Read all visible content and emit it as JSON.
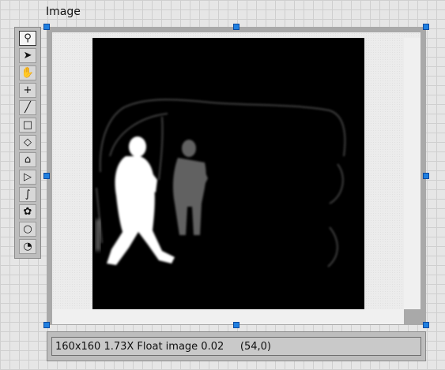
{
  "control": {
    "label": "Image"
  },
  "toolbar": {
    "tools": [
      {
        "name": "zoom-icon",
        "glyph": "⚲",
        "selected": true
      },
      {
        "name": "pointer-icon",
        "glyph": "➤",
        "selected": false
      },
      {
        "name": "pan-hand-icon",
        "glyph": "✋",
        "selected": false
      },
      {
        "name": "point-tool-icon",
        "glyph": "+",
        "selected": false
      },
      {
        "name": "line-tool-icon",
        "glyph": "╱",
        "selected": false
      },
      {
        "name": "rectangle-tool-icon",
        "glyph": "□",
        "selected": false
      },
      {
        "name": "rotated-rectangle-tool-icon",
        "glyph": "◇",
        "selected": false
      },
      {
        "name": "polyline-tool-icon",
        "glyph": "⌂",
        "selected": false
      },
      {
        "name": "polygon-tool-icon",
        "glyph": "▷",
        "selected": false
      },
      {
        "name": "freehand-line-tool-icon",
        "glyph": "∫",
        "selected": false
      },
      {
        "name": "freehand-region-tool-icon",
        "glyph": "✿",
        "selected": false
      },
      {
        "name": "oval-tool-icon",
        "glyph": "○",
        "selected": false
      },
      {
        "name": "annulus-tool-icon",
        "glyph": "◔",
        "selected": false
      }
    ]
  },
  "image": {
    "description_icon": "thermal-image"
  },
  "status": {
    "text": "160x160 1.73X Float image 0.02     (54,0)"
  },
  "colors": {
    "selection_handle": "#1f7fe0",
    "image_background": "#000000"
  }
}
